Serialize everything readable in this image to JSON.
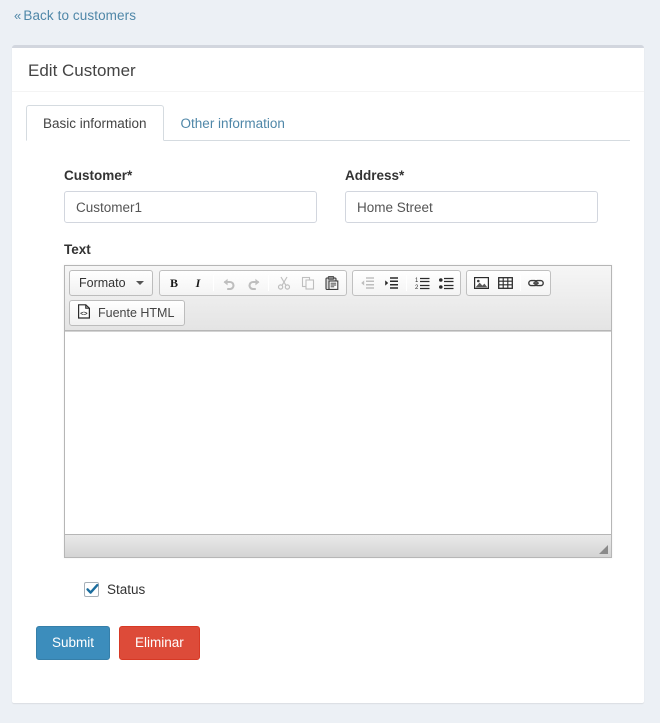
{
  "page": {
    "back_link": {
      "chevron": "«",
      "label": "Back to customers"
    },
    "card_title": "Edit Customer"
  },
  "tabs": [
    {
      "label": "Basic information",
      "active": true
    },
    {
      "label": "Other information",
      "active": false
    }
  ],
  "form": {
    "customer": {
      "label": "Customer*",
      "value": "Customer1",
      "placeholder": "Customer1"
    },
    "address": {
      "label": "Address*",
      "value": "Home Street",
      "placeholder": "Home Street"
    },
    "text": {
      "label": "Text",
      "content": ""
    },
    "status": {
      "label": "Status",
      "checked": true
    }
  },
  "editor": {
    "format_combo": {
      "label": "Formato",
      "caret": "chevron-down-icon"
    },
    "source_button": {
      "label": "Fuente HTML",
      "icon": "html-source-icon"
    },
    "toolbar_row1": [
      {
        "name": "bold",
        "title": "Negrita",
        "disabled": false
      },
      {
        "name": "italic",
        "title": "Cursiva",
        "disabled": false
      },
      {
        "name": "undo",
        "title": "Deshacer",
        "disabled": true
      },
      {
        "name": "redo",
        "title": "Rehacer",
        "disabled": true
      },
      {
        "name": "cut",
        "title": "Cortar",
        "disabled": true
      },
      {
        "name": "copy",
        "title": "Copiar",
        "disabled": true
      },
      {
        "name": "paste",
        "title": "Pegar",
        "disabled": false
      },
      {
        "name": "outdent",
        "title": "Reducir sangria",
        "disabled": true
      },
      {
        "name": "indent",
        "title": "Aumentar sangria",
        "disabled": false
      },
      {
        "name": "numbered-list",
        "title": "Lista numerada",
        "disabled": false
      },
      {
        "name": "bulleted-list",
        "title": "Lista de vinetas",
        "disabled": false
      },
      {
        "name": "image",
        "title": "Imagen",
        "disabled": false
      },
      {
        "name": "table",
        "title": "Tabla",
        "disabled": false
      },
      {
        "name": "link",
        "title": "Vinculo",
        "disabled": false
      }
    ],
    "resizer": "resize-handle-icon"
  },
  "buttons": {
    "submit": "Submit",
    "delete": "Eliminar"
  },
  "colors": {
    "page_background": "#ecf0f5",
    "card_background": "#ffffff",
    "card_top_border": "#d2d6de",
    "link": "#4f87a8",
    "primary": "#3c8dbc",
    "danger": "#dd4b39",
    "checkbox_check": "#1b6d9e",
    "text": "#333333"
  }
}
